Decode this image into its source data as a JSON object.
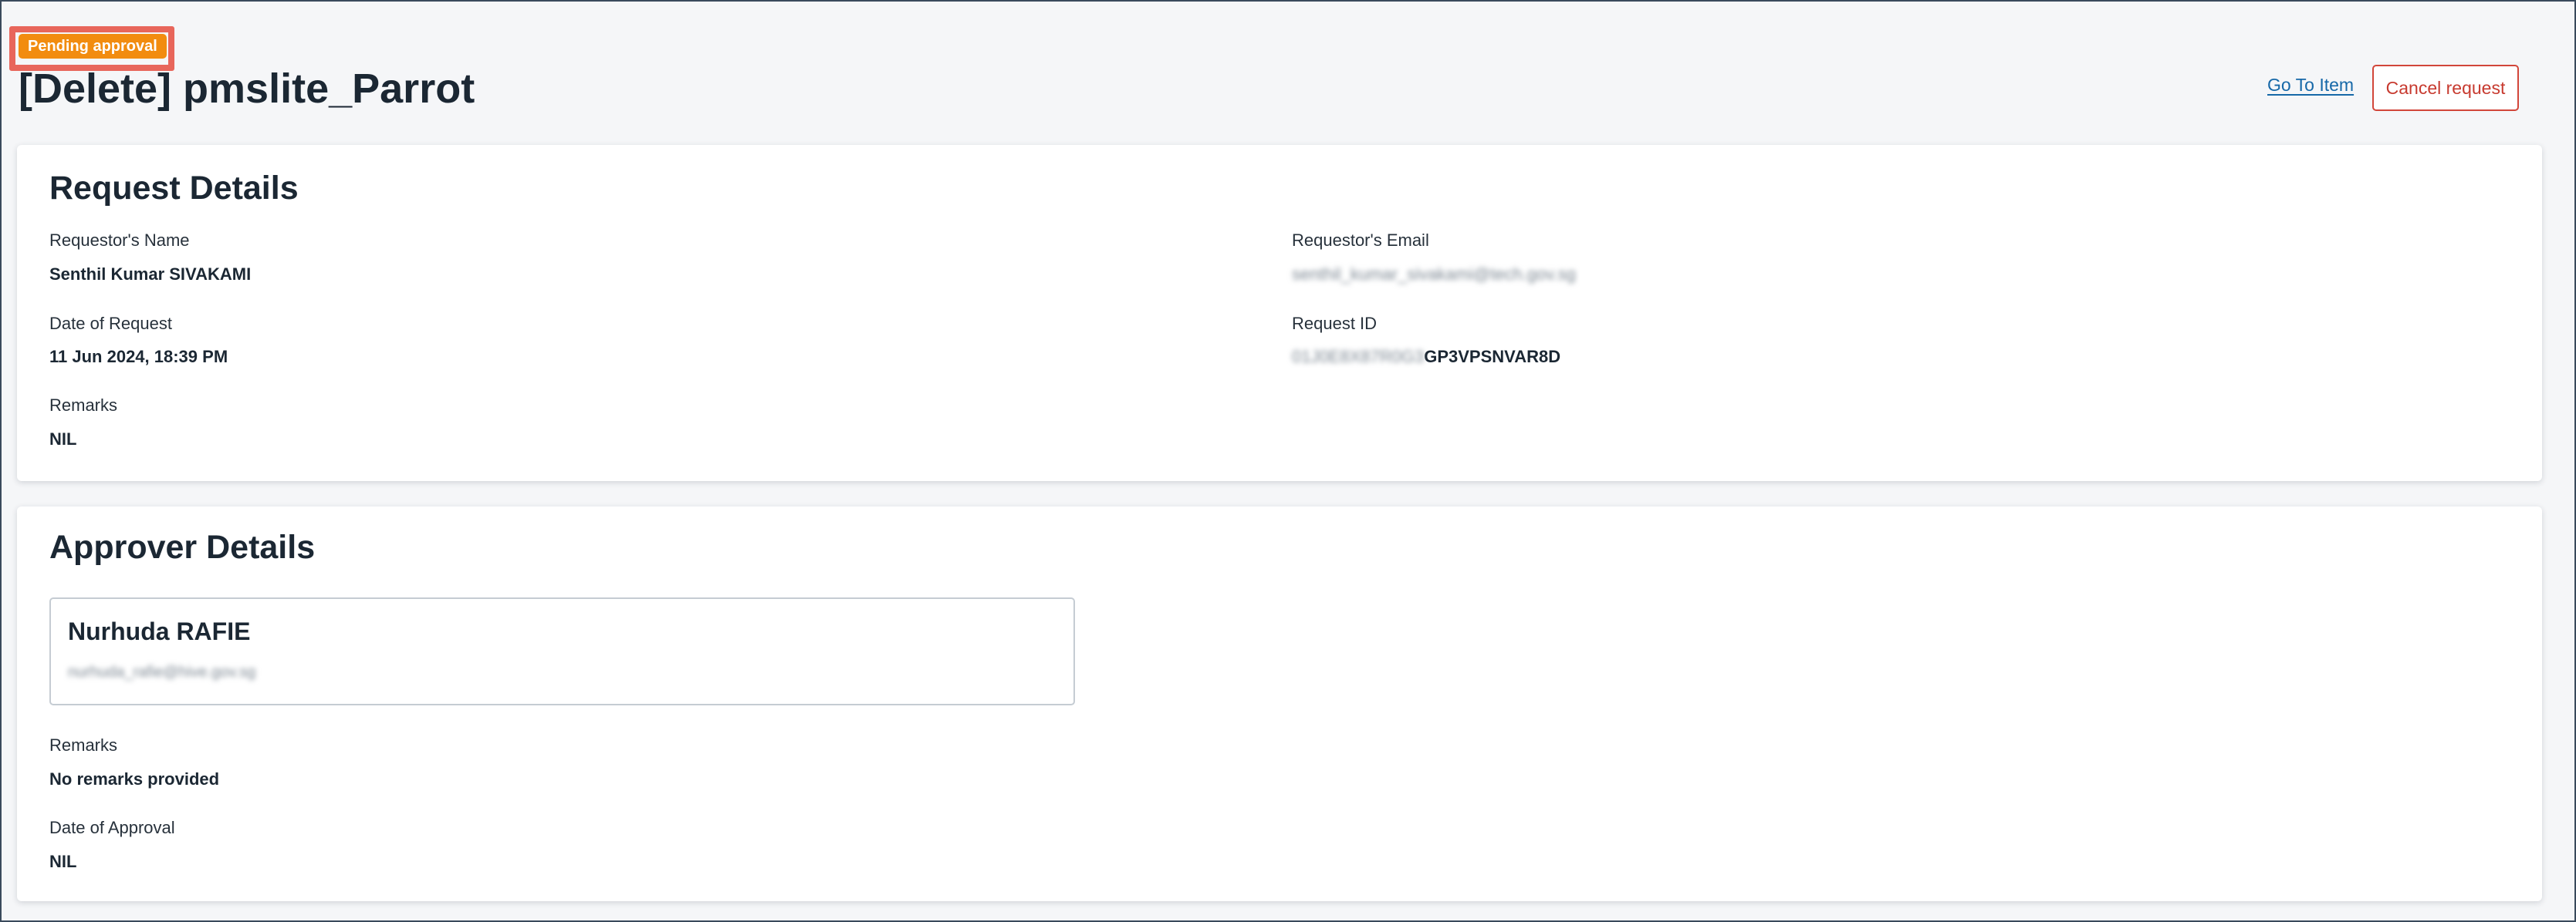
{
  "header": {
    "status_badge": "Pending approval",
    "title": "[Delete] pmslite_Parrot",
    "go_to_item_label": "Go To Item",
    "cancel_request_label": "Cancel request"
  },
  "request_details": {
    "heading": "Request Details",
    "requestor_name_label": "Requestor's Name",
    "requestor_name": "Senthil Kumar SIVAKAMI",
    "requestor_email_label": "Requestor's Email",
    "requestor_email": "senthil_kumar_sivakami@tech.gov.sg",
    "date_label": "Date of Request",
    "date": "11 Jun 2024, 18:39 PM",
    "request_id_label": "Request ID",
    "request_id_prefix": "01J0E8X87R0G3",
    "request_id_suffix": "GP3VPSNVAR8D",
    "remarks_label": "Remarks",
    "remarks": "NIL"
  },
  "approver_details": {
    "heading": "Approver Details",
    "approver_name": "Nurhuda RAFIE",
    "approver_email": "nurhuda_rafie@hive.gov.sg",
    "remarks_label": "Remarks",
    "remarks": "No remarks provided",
    "date_label": "Date of Approval",
    "date": "NIL"
  },
  "colors": {
    "badge": "#f28c0f",
    "badge_highlight": "#e8665b",
    "link": "#1668a8",
    "cancel": "#c73a2f",
    "background": "#f5f6f8"
  }
}
